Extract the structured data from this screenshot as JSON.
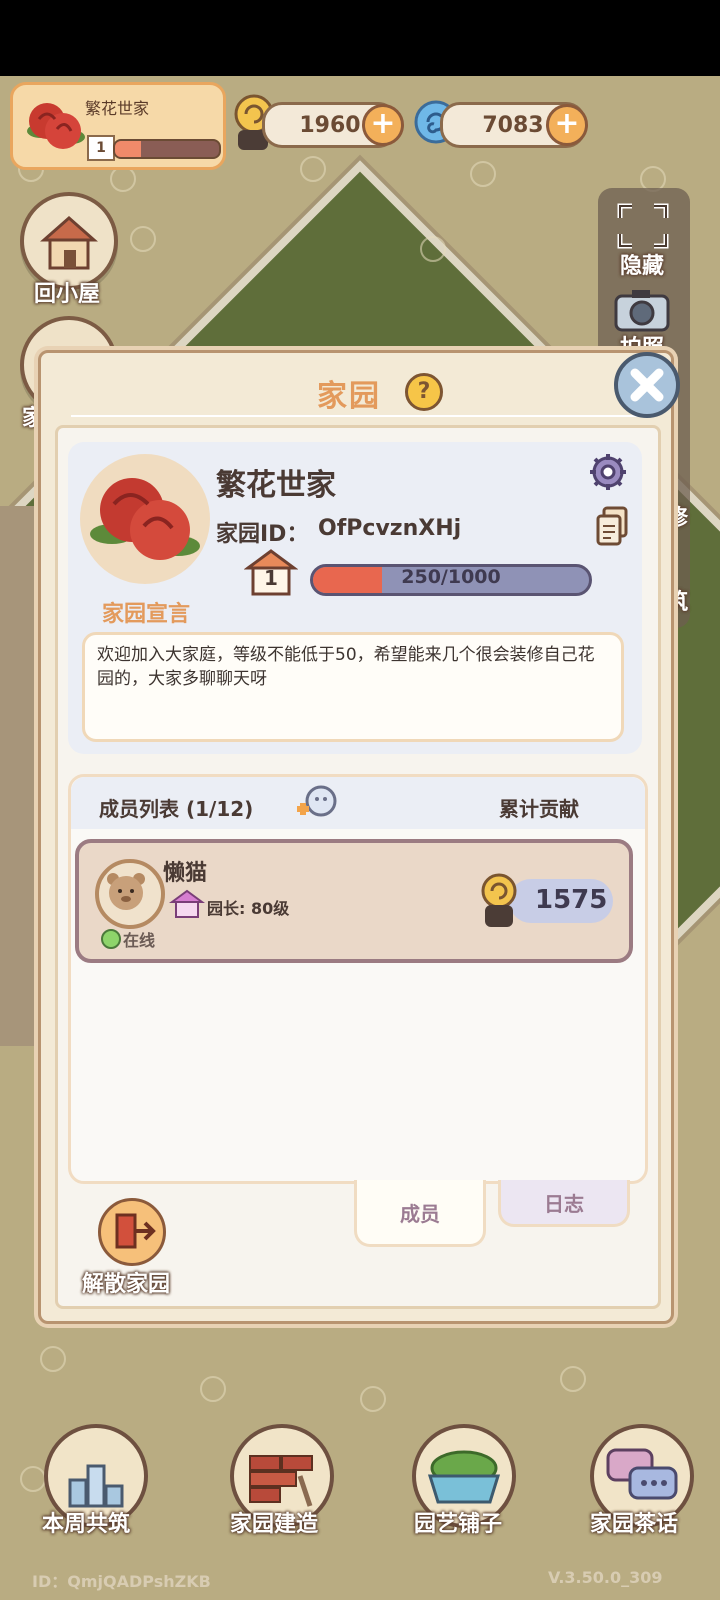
{
  "top": {
    "family_name": "繁花世家",
    "level": "1",
    "level_progress": 0.25,
    "currency1": "1960",
    "currency2": "7083"
  },
  "side": {
    "home_label": "回小屋",
    "hide_label": "隐藏",
    "photo_label": "拍照",
    "decor_label": "修",
    "build_label": "筑",
    "family_left_label": "家"
  },
  "panel": {
    "title": "家园",
    "help": "?",
    "family_name": "繁花世家",
    "id_label": "家园ID：",
    "id_value": "OfPcvznXHj",
    "level": "1",
    "exp_text": "250/1000",
    "exp_progress": 0.25,
    "declaration_title": "家园宣言",
    "declaration": "欢迎加入大家庭，等级不能低于50，希望能来几个很会装修自己花园的，大家多聊聊天呀",
    "members_title": "成员列表 (1/12)",
    "contribution_title": "累计贡献",
    "member": {
      "name": "懒猫",
      "role": "园长: 80级",
      "status": "在线",
      "contribution": "1575"
    },
    "tabs": [
      "成员",
      "日志"
    ],
    "disband": "解散家园"
  },
  "bottom": {
    "btn1": "本周共筑",
    "btn2": "家园建造",
    "btn3": "园艺铺子",
    "btn4": "家园茶话",
    "player_id": "ID：QmjQADPshZKB",
    "version": "V.3.50.0_309"
  },
  "colors": {
    "accent_orange": "#e8874e",
    "progress_fill": "#e8674f",
    "progress_track": "#8f92b6"
  }
}
